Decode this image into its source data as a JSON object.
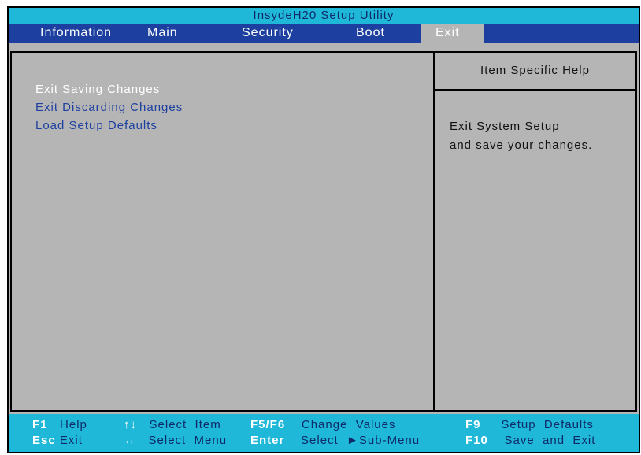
{
  "window": {
    "title": "InsydeH20 Setup Utility"
  },
  "menu": {
    "items": [
      {
        "label": "Information"
      },
      {
        "label": "Main"
      },
      {
        "label": "Security"
      },
      {
        "label": "Boot"
      },
      {
        "label": "Exit",
        "active": true
      }
    ]
  },
  "options": [
    {
      "label": "Exit Saving Changes",
      "selected": true
    },
    {
      "label": "Exit Discarding Changes",
      "selected": false
    },
    {
      "label": "Load Setup Defaults",
      "selected": false
    }
  ],
  "help": {
    "title": "Item Specific Help",
    "line1": "Exit System Setup",
    "line2": "and save your changes."
  },
  "footer": {
    "row1": [
      {
        "key": "F1",
        "label": "Help"
      },
      {
        "key": "↑↓",
        "label": "Select  Item"
      },
      {
        "key": "F5/F6",
        "label": "Change  Values"
      },
      {
        "key": "F9",
        "label": "Setup  Defaults"
      }
    ],
    "row2": [
      {
        "key": "Esc",
        "label": "Exit"
      },
      {
        "key": "↔",
        "label": "Select  Menu"
      },
      {
        "key": "Enter",
        "label": "Select  ►Sub-Menu"
      },
      {
        "key": "F10",
        "label": "Save  and  Exit"
      }
    ]
  },
  "colors": {
    "title_bar": "#20b8d8",
    "menu_bar": "#1c3fa0",
    "panel": "#b5b5b5",
    "selected_text": "#ffffff",
    "option_text": "#1c3fa0"
  }
}
